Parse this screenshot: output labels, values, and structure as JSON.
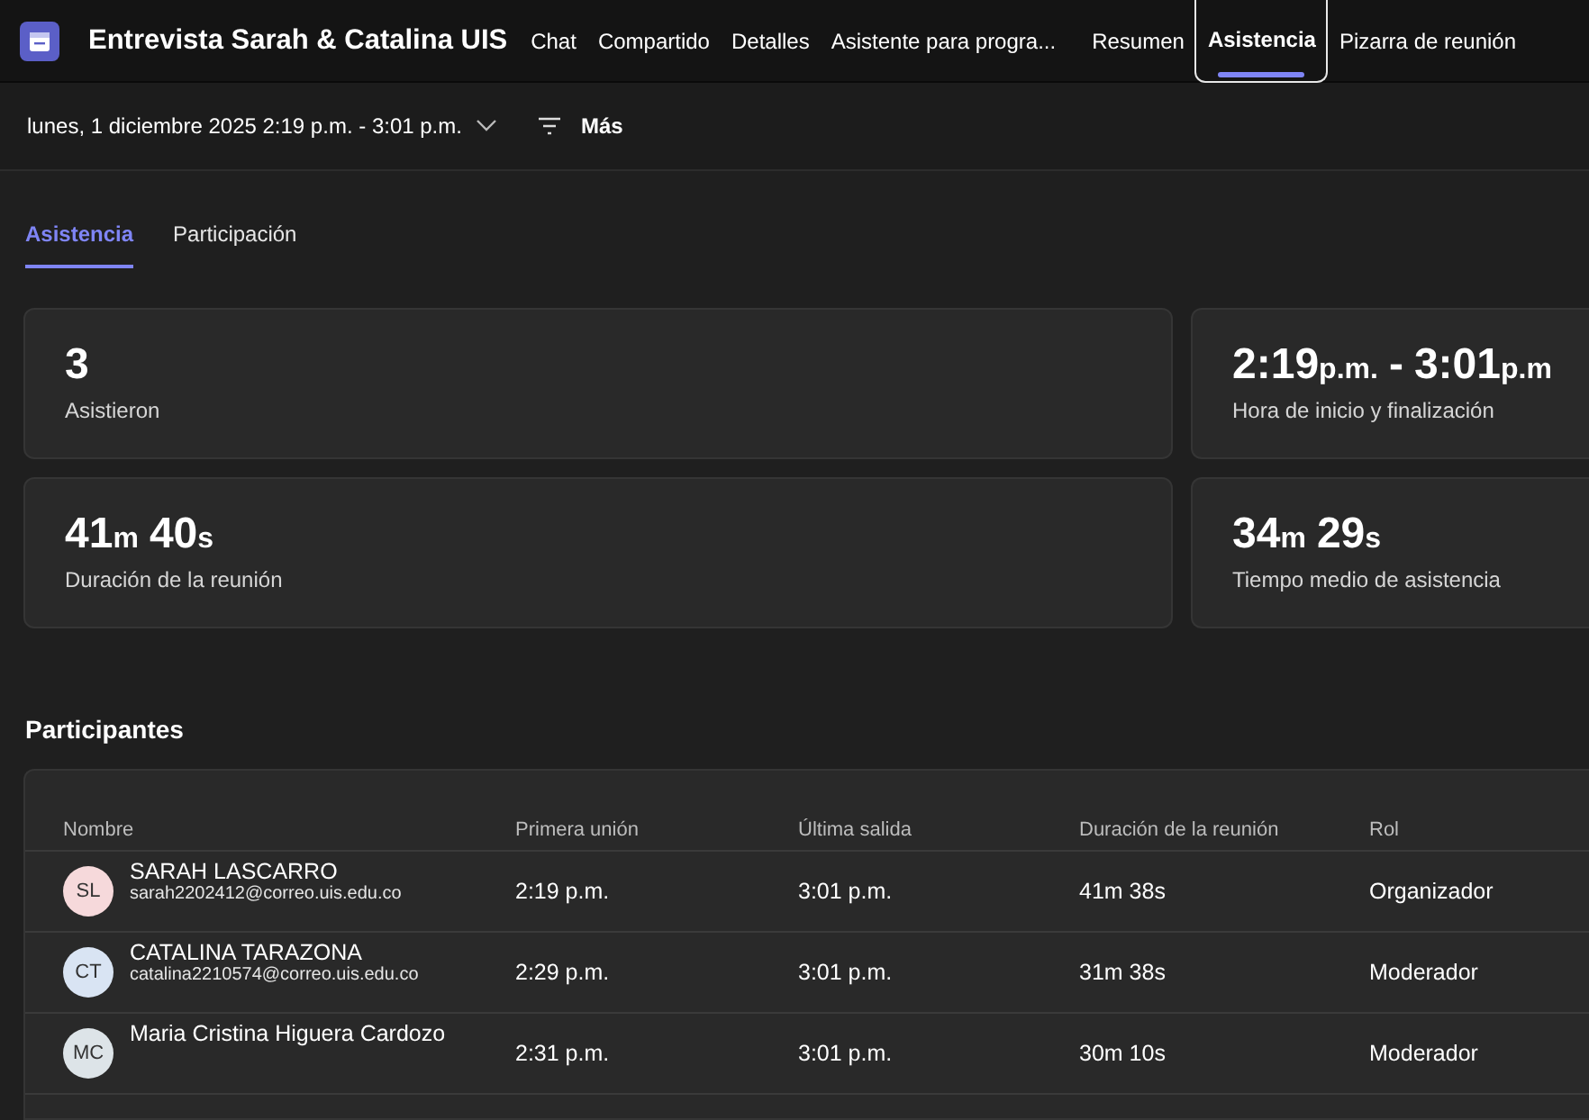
{
  "header": {
    "title": "Entrevista Sarah & Catalina UIS",
    "tabs": [
      {
        "label": "Chat",
        "selected": false
      },
      {
        "label": "Compartido",
        "selected": false
      },
      {
        "label": "Detalles",
        "selected": false
      },
      {
        "label": "Asistente para progra...",
        "selected": false
      },
      {
        "label": "Resumen",
        "selected": false
      },
      {
        "label": "Asistencia",
        "selected": true
      },
      {
        "label": "Pizarra de reunión",
        "selected": false
      }
    ]
  },
  "toolbar": {
    "date_range": "lunes, 1 diciembre 2025 2:19 p.m. - 3:01 p.m.",
    "filter": "Más"
  },
  "subtabs": [
    {
      "label": "Asistencia",
      "selected": true
    },
    {
      "label": "Participación",
      "selected": false
    }
  ],
  "stats": [
    {
      "value": [
        {
          "text": "3",
          "kind": "number"
        }
      ],
      "label": "Asistieron"
    },
    {
      "value": [
        {
          "text": "2:19",
          "kind": "number"
        },
        {
          "text": "p.m.",
          "kind": "unit"
        },
        {
          "text": "-",
          "kind": "number"
        },
        {
          "text": "3:01",
          "kind": "number"
        },
        {
          "text": "p.m",
          "kind": "unit"
        }
      ],
      "label": "Hora de inicio y finalización"
    },
    {
      "value": [
        {
          "text": "41",
          "kind": "number"
        },
        {
          "text": "m",
          "kind": "unit"
        },
        {
          "text": "40",
          "kind": "number"
        },
        {
          "text": "s",
          "kind": "unit"
        }
      ],
      "label": "Duración de la reunión"
    },
    {
      "value": [
        {
          "text": "34",
          "kind": "number"
        },
        {
          "text": "m",
          "kind": "unit"
        },
        {
          "text": "29",
          "kind": "number"
        },
        {
          "text": "s",
          "kind": "unit"
        }
      ],
      "label": "Tiempo medio de asistencia"
    }
  ],
  "participants": {
    "heading": "Participantes",
    "columns": [
      "Nombre",
      "Primera unión",
      "Última salida",
      "Duración de la reunión",
      "Rol"
    ],
    "rows": [
      {
        "initials": "SL",
        "color": "#f6d9db",
        "name": "SARAH LASCARRO",
        "email": "sarah2202412@correo.uis.edu.co",
        "first_join": "2:19 p.m.",
        "last_leave": "3:01 p.m.",
        "duration": "41m 38s",
        "role": "Organizador"
      },
      {
        "initials": "CT",
        "color": "#d9e4f3",
        "name": "CATALINA TARAZONA",
        "email": "catalina2210574@correo.uis.edu.co",
        "first_join": "2:29 p.m.",
        "last_leave": "3:01 p.m.",
        "duration": "31m 38s",
        "role": "Moderador"
      },
      {
        "initials": "MC",
        "color": "#dde4e8",
        "name": "Maria Cristina Higuera Cardozo",
        "first_join": "2:31 p.m.",
        "last_leave": "3:01 p.m.",
        "duration": "30m 10s",
        "role": "Moderador"
      }
    ]
  }
}
